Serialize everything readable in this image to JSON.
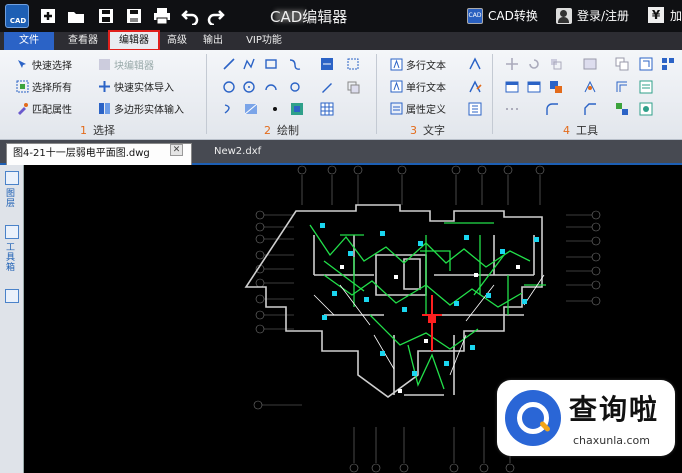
{
  "titlebar": {
    "app_logo_text": "CAD",
    "title": "CAD编辑器",
    "cad_convert_label": "CAD转换",
    "cad_convert_icon_text": "CAD",
    "login_label": "登录/注册",
    "currency_symbol": "¥",
    "overflow_text": "加",
    "icons": [
      "new-icon",
      "open-icon",
      "save-icon",
      "save-as-icon",
      "print-icon",
      "undo-icon",
      "redo-icon"
    ]
  },
  "menu": {
    "file": "文件",
    "viewer": "查看器",
    "editor": "编辑器",
    "advanced": "高级",
    "output": "输出",
    "vip": "VIP功能",
    "highlight_color": "#e0201c"
  },
  "ribbon": {
    "select": {
      "quick_select": "快速选择",
      "select_all": "选择所有",
      "match_properties": "匹配属性",
      "block_editor": "块编辑器",
      "quick_entity_import": "快速实体导入",
      "polygon_entity_input": "多边形实体输入",
      "label_num": "1",
      "label": "选择"
    },
    "draw": {
      "label_num": "2",
      "label": "绘制"
    },
    "text": {
      "multiline_text": "多行文本",
      "singleline_text": "单行文本",
      "attribute_define": "属性定义",
      "label_num": "3",
      "label": "文字"
    },
    "tools": {
      "label_num": "4",
      "label": "工具"
    }
  },
  "tabs": {
    "active": "图4-21十一层弱电平面图.dwg",
    "close_glyph": "✕",
    "second": "New2.dxf"
  },
  "dock": {
    "layers": "图层",
    "toolbox": "工具箱",
    "hand_written_text": ""
  },
  "watermark": {
    "brand": "查询啦",
    "url": "chaxunla.com"
  },
  "colors": {
    "accent_blue": "#2b63c6",
    "canvas_bg": "#000000",
    "wire_green": "#22e04a",
    "section_number": "#e36b1b"
  }
}
